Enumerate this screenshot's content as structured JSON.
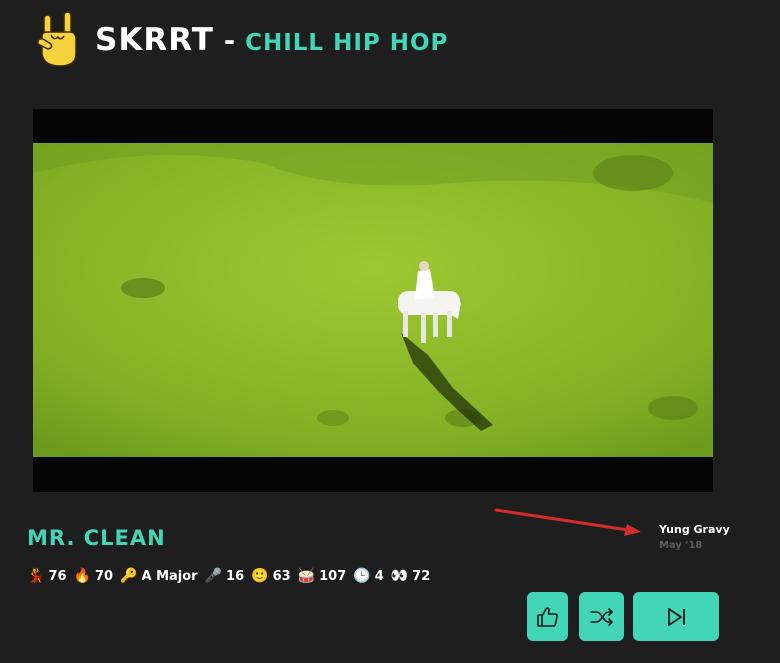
{
  "header": {
    "logo_icon": "rock-hand-icon",
    "app_name": "SKRRT",
    "separator": "-",
    "genre": "CHILL HIP HOP"
  },
  "video": {
    "content": "video-frame"
  },
  "track": {
    "title": "MR. CLEAN",
    "artist": "Yung Gravy",
    "release": "May '18"
  },
  "stats": [
    {
      "icon": "💃",
      "value": "76"
    },
    {
      "icon": "🔥",
      "value": "70"
    },
    {
      "icon": "🔑",
      "value": "A Major"
    },
    {
      "icon": "🎤",
      "value": "16"
    },
    {
      "icon": "🙂",
      "value": "63"
    },
    {
      "icon": "🥁",
      "value": "107"
    },
    {
      "icon": "🕒",
      "value": "4"
    },
    {
      "icon": "👀",
      "value": "72"
    }
  ],
  "controls": {
    "like_icon": "thumbs-up-icon",
    "shuffle_icon": "shuffle-icon",
    "next_icon": "skip-next-icon"
  },
  "colors": {
    "background": "#1e1e1e",
    "accent": "#43d6b6",
    "annotation_arrow": "#d42b2b",
    "muted_text": "#5d5d5d"
  }
}
